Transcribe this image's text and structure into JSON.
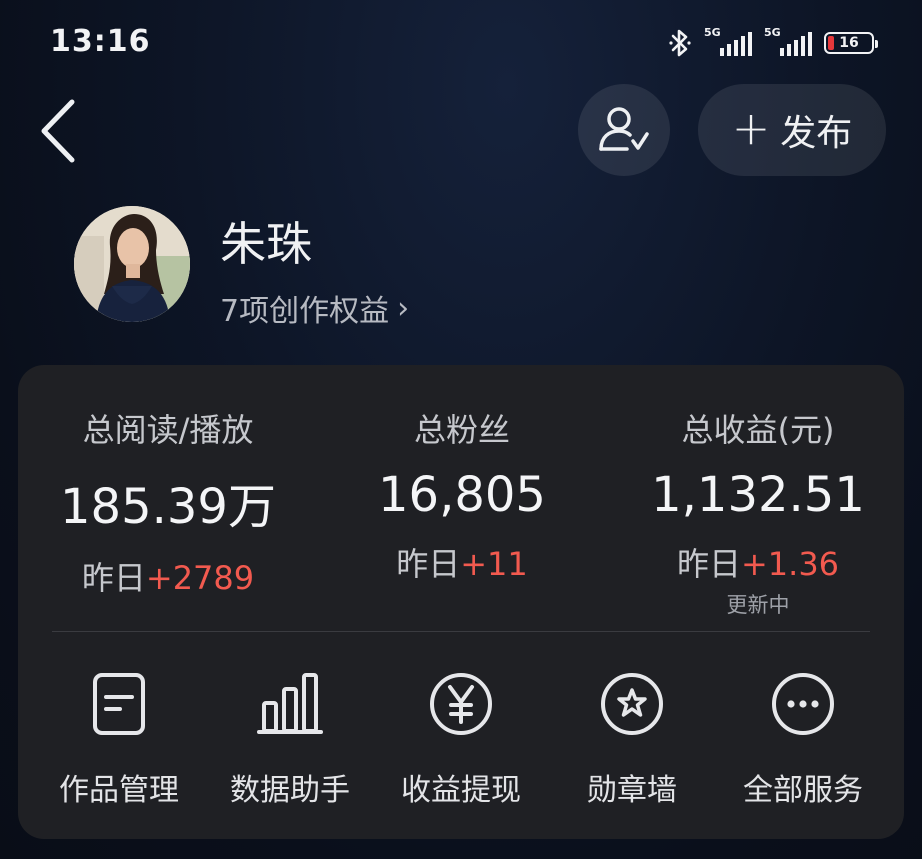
{
  "status_bar": {
    "time": "13:16",
    "signal1_label": "5G",
    "signal2_label": "5G",
    "battery_level": "16",
    "icons": [
      "bluetooth-icon",
      "signal-icon",
      "signal-icon",
      "battery-icon"
    ],
    "battery_color": "#e5383b"
  },
  "header": {
    "back_icon": "chevron-left-icon",
    "follow_icon": "user-check-icon",
    "publish_label": "发布",
    "publish_icon": "plus-icon"
  },
  "profile": {
    "name": "朱珠",
    "benefits_label": "7项创作权益",
    "benefits_chevron": "›"
  },
  "stats": [
    {
      "label": "总阅读/播放",
      "value": "185.39万",
      "delta_prefix": "昨日",
      "delta_value": "+2789",
      "note": ""
    },
    {
      "label": "总粉丝",
      "value": "16,805",
      "delta_prefix": "昨日",
      "delta_value": "+11",
      "note": ""
    },
    {
      "label": "总收益(元)",
      "value": "1,132.51",
      "delta_prefix": "昨日",
      "delta_value": "+1.36",
      "note": "更新中"
    }
  ],
  "services": [
    {
      "label": "作品管理",
      "icon": "document-icon"
    },
    {
      "label": "数据助手",
      "icon": "bar-chart-icon"
    },
    {
      "label": "收益提现",
      "icon": "yen-icon"
    },
    {
      "label": "勋章墙",
      "icon": "badge-icon"
    },
    {
      "label": "全部服务",
      "icon": "more-icon"
    }
  ],
  "colors": {
    "accent_positive": "#f25a4f",
    "card_bg": "#1f2024",
    "page_bg": "#0c1220"
  }
}
